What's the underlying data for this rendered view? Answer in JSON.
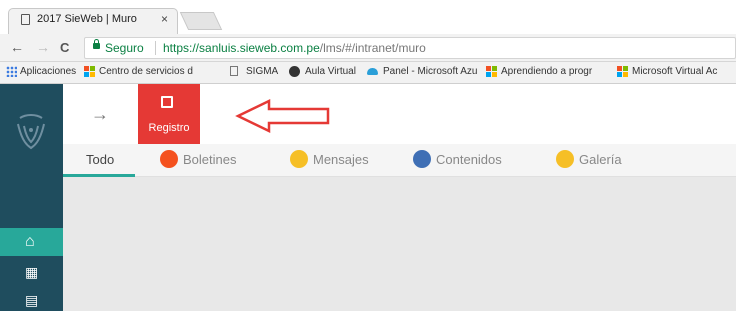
{
  "browser": {
    "tab_title": "2017 SieWeb | Muro",
    "tab_close": "×",
    "address": {
      "secure_label": "Seguro",
      "separator": "|",
      "url_base": "https://sanluis.sieweb.com.pe",
      "url_path": "/lms/#/intranet/muro"
    },
    "nav": {
      "back": "←",
      "forward": "→",
      "reload": "C"
    },
    "bookmarks": [
      {
        "label": "Aplicaciones",
        "icon": "apps-grid-icon"
      },
      {
        "label": "Centro de servicios d",
        "icon": "microsoft-icon"
      },
      {
        "label": "SIGMA",
        "icon": "page-icon"
      },
      {
        "label": "Aula Virtual",
        "icon": "moodle-icon"
      },
      {
        "label": "Panel - Microsoft Azu",
        "icon": "azure-icon"
      },
      {
        "label": "Aprendiendo a progr",
        "icon": "microsoft-icon"
      },
      {
        "label": "Microsoft Virtual Ac",
        "icon": "microsoft-icon"
      }
    ]
  },
  "sidebar": {
    "logo": "school-crest-logo",
    "items": [
      {
        "icon": "home-icon",
        "glyph": "⌂",
        "active": true
      },
      {
        "icon": "calendar-icon",
        "glyph": "▦"
      },
      {
        "icon": "document-icon",
        "glyph": "▤"
      }
    ]
  },
  "toolbar": {
    "back_icon": "→",
    "registro_label": "Registro",
    "registro_icon": "edit-note-icon",
    "annotation": "red-outline-arrow"
  },
  "filters": {
    "tabs": [
      {
        "label": "Todo",
        "active": true
      },
      {
        "label": "Boletines",
        "icon": "boletines-icon",
        "color": "#f4511e"
      },
      {
        "label": "Mensajes",
        "icon": "mensajes-icon",
        "color": "#f6bf26"
      },
      {
        "label": "Contenidos",
        "icon": "contenidos-icon",
        "color": "#3f6fb5"
      },
      {
        "label": "Galería",
        "icon": "galeria-icon",
        "color": "#f6bf26"
      }
    ]
  },
  "colors": {
    "sidebar": "#1f4d5e",
    "accent": "#28a89a",
    "registro": "#e53935",
    "arrow": "#e53935"
  }
}
